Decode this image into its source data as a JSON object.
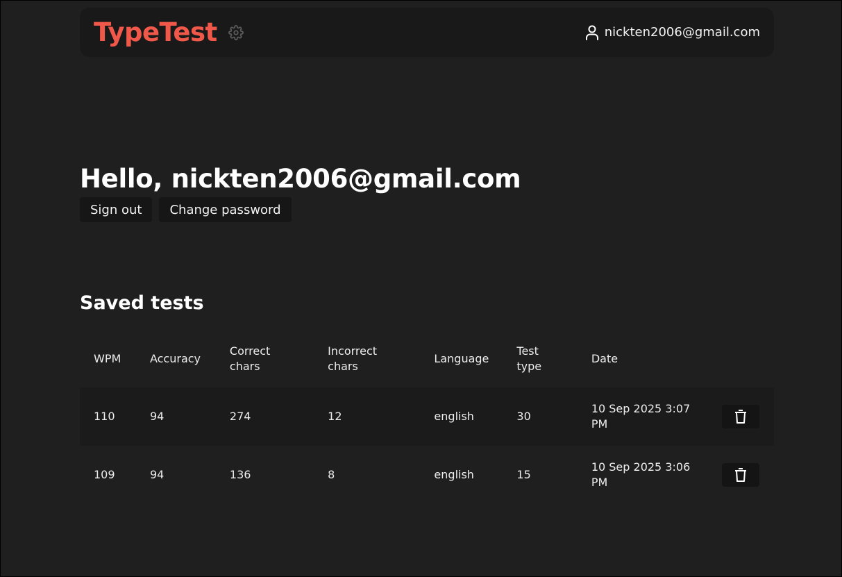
{
  "colors": {
    "brand": "#f0594a",
    "background": "#1f1f1f",
    "navbar": "#191919",
    "button": "#161616"
  },
  "navbar": {
    "logo_text": "TypeTest",
    "settings_icon": "gear-icon",
    "account_icon": "user-icon",
    "account_email": "nickten2006@gmail.com"
  },
  "profile": {
    "greeting": "Hello, nickten2006@gmail.com",
    "sign_out_label": "Sign out",
    "change_password_label": "Change password"
  },
  "saved_tests": {
    "title": "Saved tests",
    "headers": [
      "WPM",
      "Accuracy",
      "Correct chars",
      "Incorrect chars",
      "Language",
      "Test type",
      "Date"
    ],
    "rows": [
      {
        "wpm": "110",
        "accuracy": "94",
        "correct": "274",
        "incorrect": "12",
        "language": "english",
        "test_type": "30",
        "date": "10 Sep 2025 3:07 PM"
      },
      {
        "wpm": "109",
        "accuracy": "94",
        "correct": "136",
        "incorrect": "8",
        "language": "english",
        "test_type": "15",
        "date": "10 Sep 2025 3:06 PM"
      }
    ],
    "delete_icon": "trash-icon"
  }
}
